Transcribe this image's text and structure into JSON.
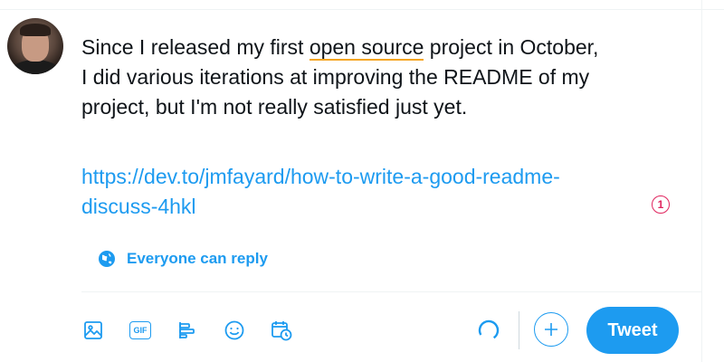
{
  "composer": {
    "text_lines": {
      "line1_before": "Since I released my first ",
      "line1_underlined": "open source",
      "line1_after": " project in October,",
      "line2": "I did various iterations at improving the README of my",
      "line3": "project, but I'm not really satisfied just yet."
    },
    "link_line1": "https://dev.to/jmfayard/how-to-write-a-good-readme-",
    "link_line2": "discuss-4hkl",
    "error_badge": "1"
  },
  "reply_setting": {
    "label": "Everyone can reply",
    "icon": "globe-icon"
  },
  "toolbar": {
    "icons": [
      "image-icon",
      "gif-icon",
      "poll-icon",
      "emoji-icon",
      "schedule-icon"
    ],
    "gif_label": "GIF"
  },
  "actions": {
    "add_icon": "plus-icon",
    "tweet_label": "Tweet"
  },
  "colors": {
    "accent": "#1d9bf0",
    "underline": "#f5a623",
    "error": "#e0245e",
    "text": "#0f1419"
  }
}
